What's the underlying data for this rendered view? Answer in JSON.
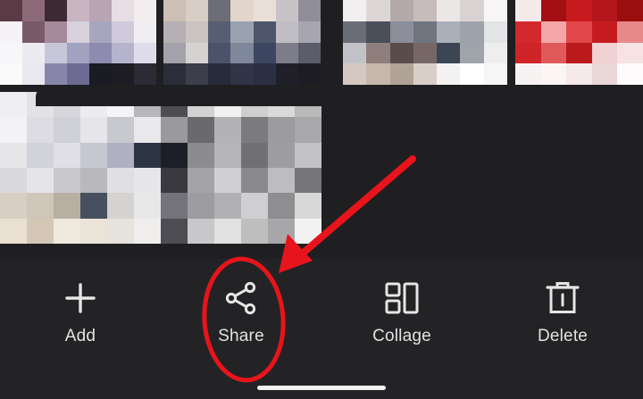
{
  "toolbar": {
    "items": [
      {
        "label": "Add",
        "icon": "plus-icon"
      },
      {
        "label": "Share",
        "icon": "share-icon"
      },
      {
        "label": "Collage",
        "icon": "collage-icon"
      },
      {
        "label": "Delete",
        "icon": "trash-icon"
      }
    ]
  },
  "annotation": {
    "color": "#e8141b",
    "target": "Share"
  },
  "colors": {
    "background": "#1f1f22",
    "toolbar": "#232326",
    "icon": "#e6e6e6"
  }
}
